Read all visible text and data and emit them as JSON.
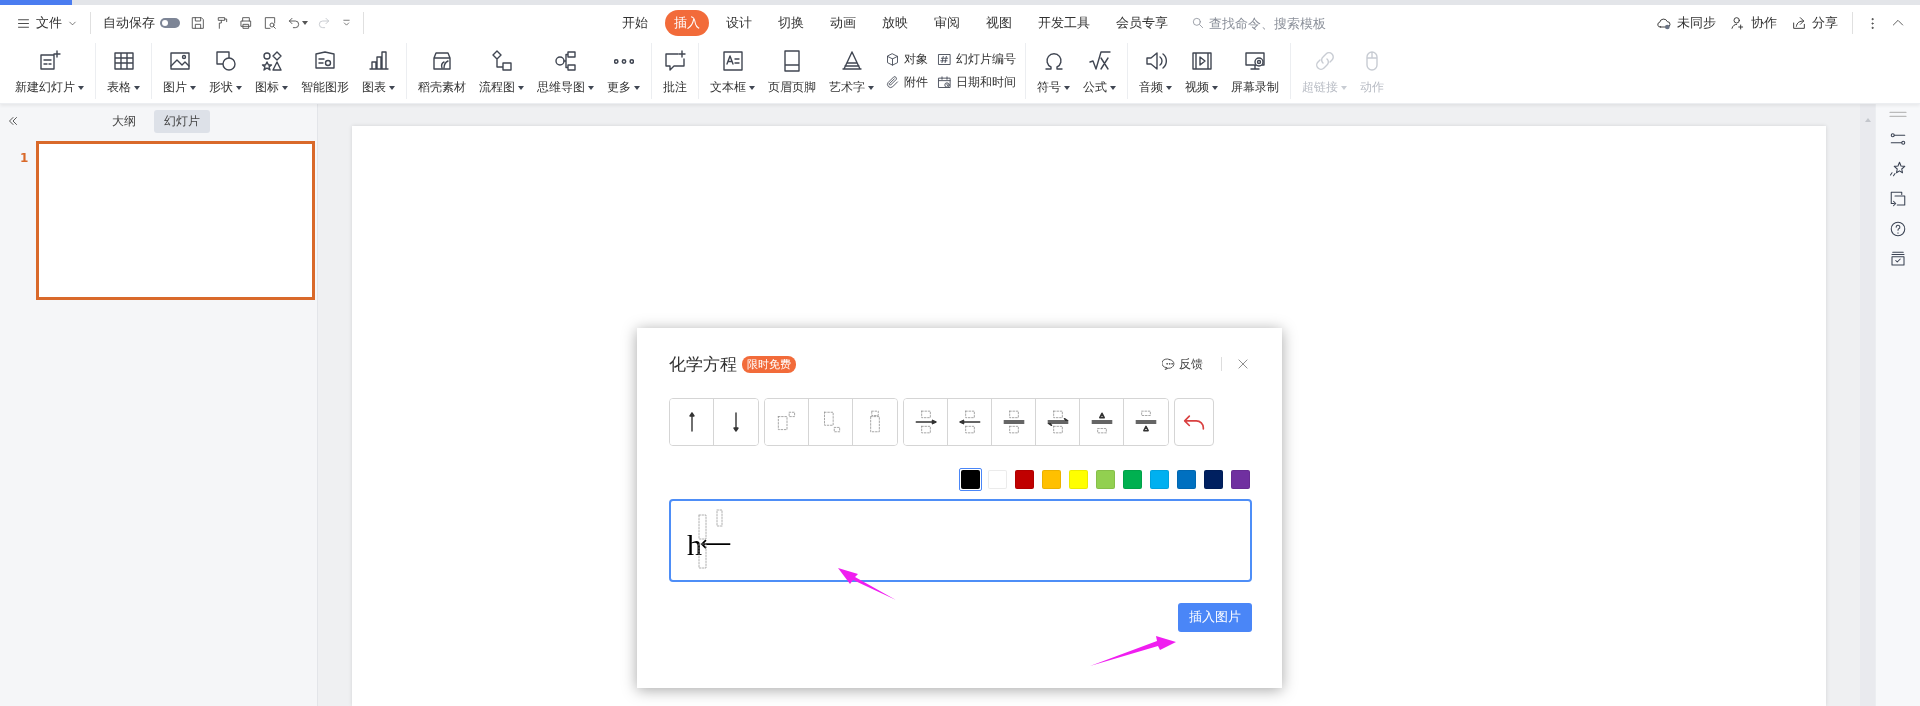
{
  "menu": {
    "file": "文件",
    "autosave": {
      "label": "自动保存",
      "on": false
    },
    "tabs": [
      {
        "label": "开始",
        "selected": false
      },
      {
        "label": "插入",
        "selected": true
      },
      {
        "label": "设计",
        "selected": false
      },
      {
        "label": "切换",
        "selected": false
      },
      {
        "label": "动画",
        "selected": false
      },
      {
        "label": "放映",
        "selected": false
      },
      {
        "label": "审阅",
        "selected": false
      },
      {
        "label": "视图",
        "selected": false
      },
      {
        "label": "开发工具",
        "selected": false
      },
      {
        "label": "会员专享",
        "selected": false
      }
    ],
    "search": {
      "placeholder": "查找命令、搜索模板"
    },
    "actions": [
      "未同步",
      "协作",
      "分享"
    ]
  },
  "ribbon": {
    "groups": [
      [
        {
          "kind": "large",
          "label": "新建幻灯片",
          "dropdown": true,
          "disabled": false
        }
      ],
      [
        {
          "kind": "large",
          "label": "表格",
          "dropdown": true,
          "disabled": false
        }
      ],
      [
        {
          "kind": "large",
          "label": "图片",
          "dropdown": true,
          "disabled": false
        },
        {
          "kind": "large",
          "label": "形状",
          "dropdown": true,
          "disabled": false
        },
        {
          "kind": "large",
          "label": "图标",
          "dropdown": true,
          "disabled": false
        },
        {
          "kind": "large",
          "label": "智能图形",
          "dropdown": false,
          "disabled": false
        },
        {
          "kind": "large",
          "label": "图表",
          "dropdown": true,
          "disabled": false
        }
      ],
      [
        {
          "kind": "large",
          "label": "稻壳素材",
          "dropdown": false,
          "disabled": false
        },
        {
          "kind": "large",
          "label": "流程图",
          "dropdown": true,
          "disabled": false
        },
        {
          "kind": "large",
          "label": "思维导图",
          "dropdown": true,
          "disabled": false
        },
        {
          "kind": "large",
          "label": "更多",
          "dropdown": true,
          "disabled": false
        }
      ],
      [
        {
          "kind": "large",
          "label": "批注",
          "dropdown": false,
          "disabled": false
        }
      ],
      [
        {
          "kind": "large",
          "label": "文本框",
          "dropdown": true,
          "disabled": false
        },
        {
          "kind": "large",
          "label": "页眉页脚",
          "dropdown": false,
          "disabled": false
        },
        {
          "kind": "large",
          "label": "艺术字",
          "dropdown": true,
          "disabled": false
        },
        {
          "kind": "stack",
          "items": [
            "对象",
            "附件"
          ]
        },
        {
          "kind": "stack",
          "items": [
            "幻灯片编号",
            "日期和时间"
          ]
        }
      ],
      [
        {
          "kind": "large",
          "label": "符号",
          "dropdown": true,
          "disabled": false
        },
        {
          "kind": "large",
          "label": "公式",
          "dropdown": true,
          "disabled": false
        }
      ],
      [
        {
          "kind": "large",
          "label": "音频",
          "dropdown": true,
          "disabled": false
        },
        {
          "kind": "large",
          "label": "视频",
          "dropdown": true,
          "disabled": false
        },
        {
          "kind": "large",
          "label": "屏幕录制",
          "dropdown": false,
          "disabled": false
        }
      ],
      [
        {
          "kind": "large",
          "label": "超链接",
          "dropdown": true,
          "disabled": true
        },
        {
          "kind": "large",
          "label": "动作",
          "dropdown": false,
          "disabled": true
        }
      ]
    ]
  },
  "panel": {
    "tabs": [
      {
        "label": "大纲",
        "selected": false
      },
      {
        "label": "幻灯片",
        "selected": true
      }
    ],
    "slides": [
      {
        "number": "1",
        "selected": true
      }
    ]
  },
  "dialog": {
    "title": "化学方程",
    "badge": "限时免费",
    "feedback": "反馈",
    "colors": [
      {
        "color": "#000000",
        "selected": true
      },
      {
        "color": "#ffffff",
        "selected": false
      },
      {
        "color": "#c00000",
        "selected": false
      },
      {
        "color": "#ffc000",
        "selected": false
      },
      {
        "color": "#ffff00",
        "selected": false
      },
      {
        "color": "#92d050",
        "selected": false
      },
      {
        "color": "#00b050",
        "selected": false
      },
      {
        "color": "#00b0f0",
        "selected": false
      },
      {
        "color": "#0070c0",
        "selected": false
      },
      {
        "color": "#002060",
        "selected": false
      },
      {
        "color": "#7030a0",
        "selected": false
      }
    ],
    "editor": {
      "formula": "h",
      "arrow": "⟵"
    },
    "insert_button": "插入图片"
  }
}
